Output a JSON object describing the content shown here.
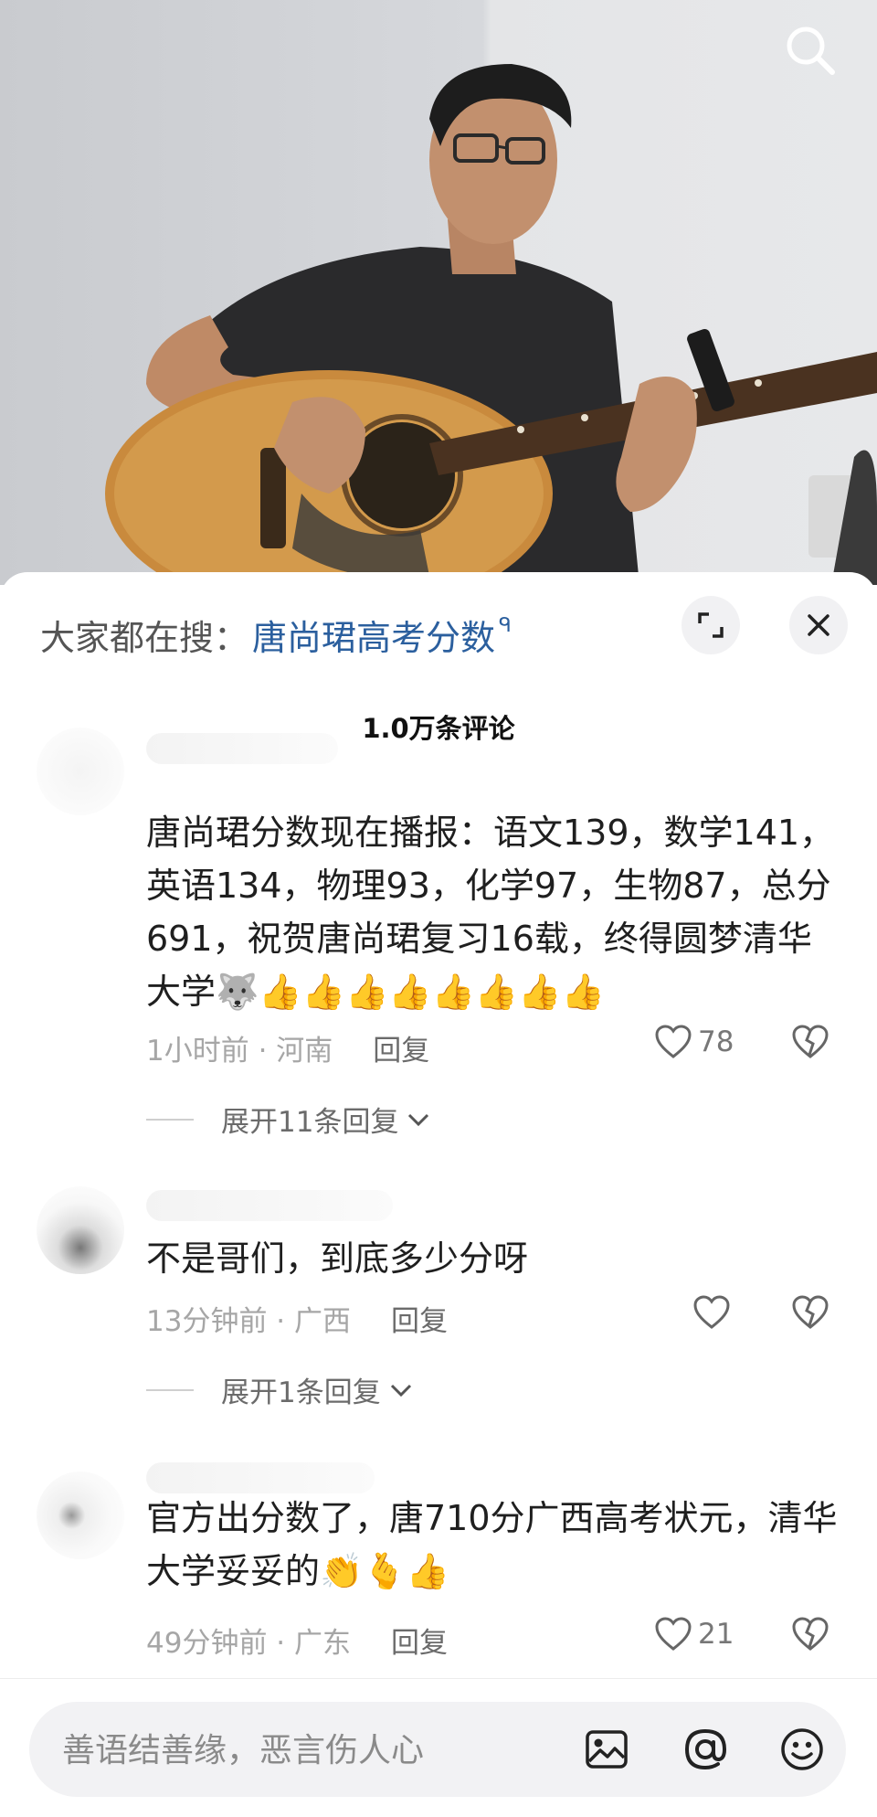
{
  "search": {
    "prefix": "大家都在搜：",
    "term": "唐尚珺高考分数",
    "glyph": "ᑫ"
  },
  "comment_count": "1.0万条评论",
  "comments": [
    {
      "text": "唐尚珺分数现在播报：语文139，数学141，英语134，物理93，化学97，生物87，总分691，祝贺唐尚珺复习16载，终得圆梦清华大学🐺👍👍👍👍👍👍👍👍",
      "time": "1小时前 · 河南",
      "reply": "回复",
      "likes": "78",
      "expand": "展开11条回复"
    },
    {
      "text": "不是哥们，到底多少分呀",
      "time": "13分钟前 · 广西",
      "reply": "回复",
      "likes": "",
      "expand": "展开1条回复"
    },
    {
      "text": "官方出分数了，唐710分广西高考状元，清华大学妥妥的👏🫰👍",
      "time": "49分钟前 · 广东",
      "reply": "回复",
      "likes": "21"
    }
  ],
  "input": {
    "placeholder": "善语结善缘，恶言伤人心"
  },
  "icons": {
    "search": "search-icon",
    "expand": "expand-icon",
    "close": "close-icon",
    "heart": "heart-icon",
    "dislike": "broken-heart-icon",
    "chevron": "chevron-down-icon",
    "image": "image-icon",
    "at": "at-icon",
    "emoji": "emoji-icon"
  },
  "colors": {
    "accent_link": "#2b5f9e",
    "meta_gray": "#a6a6a6"
  }
}
